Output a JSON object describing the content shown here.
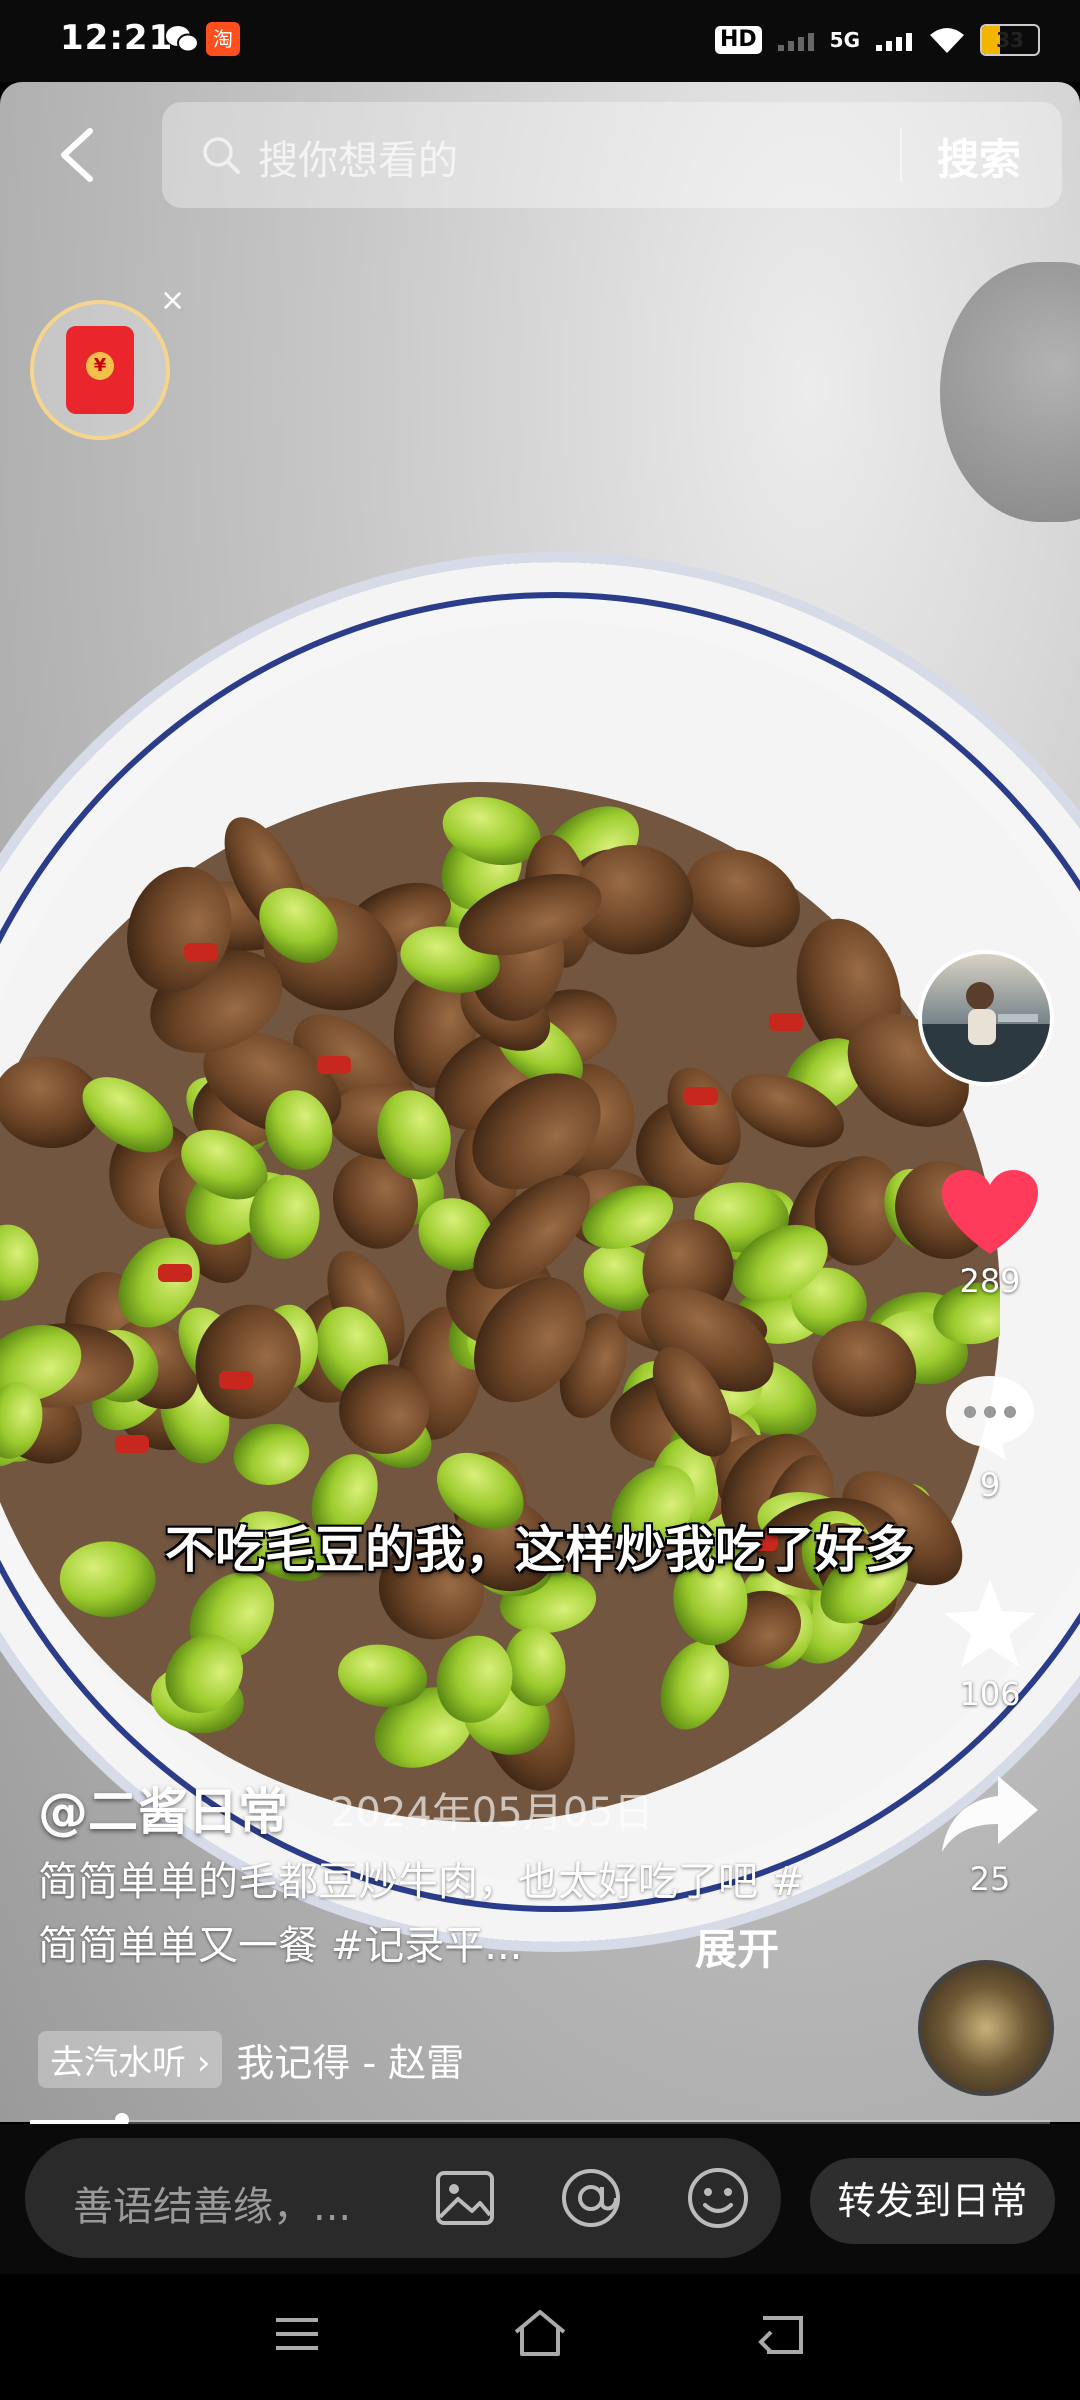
{
  "status_bar": {
    "time": "12:21",
    "battery": "33",
    "network": "5G"
  },
  "search": {
    "placeholder": "搜你想看的",
    "button": "搜索"
  },
  "actions": {
    "likes": "289",
    "comments": "9",
    "favorites": "106",
    "shares": "25"
  },
  "subtitle": "不吃毛豆的我，这样炒我吃了好多",
  "post": {
    "author": "@二酱日常",
    "date": "2024年05月05日",
    "description": "简简单单的毛都豆炒牛肉，也太好吃了吧 #简简单单又一餐 #记录平...",
    "expand": "展开"
  },
  "music": {
    "tag": "去汽水听",
    "song": "我记得 - 赵雷"
  },
  "progress": 0.09,
  "comment_bar": {
    "placeholder": "善语结善缘，...",
    "share_to_daily": "转发到日常"
  },
  "colors": {
    "like": "#ff3b5c",
    "packet": "#e8262b",
    "battery": "#f2b600"
  }
}
